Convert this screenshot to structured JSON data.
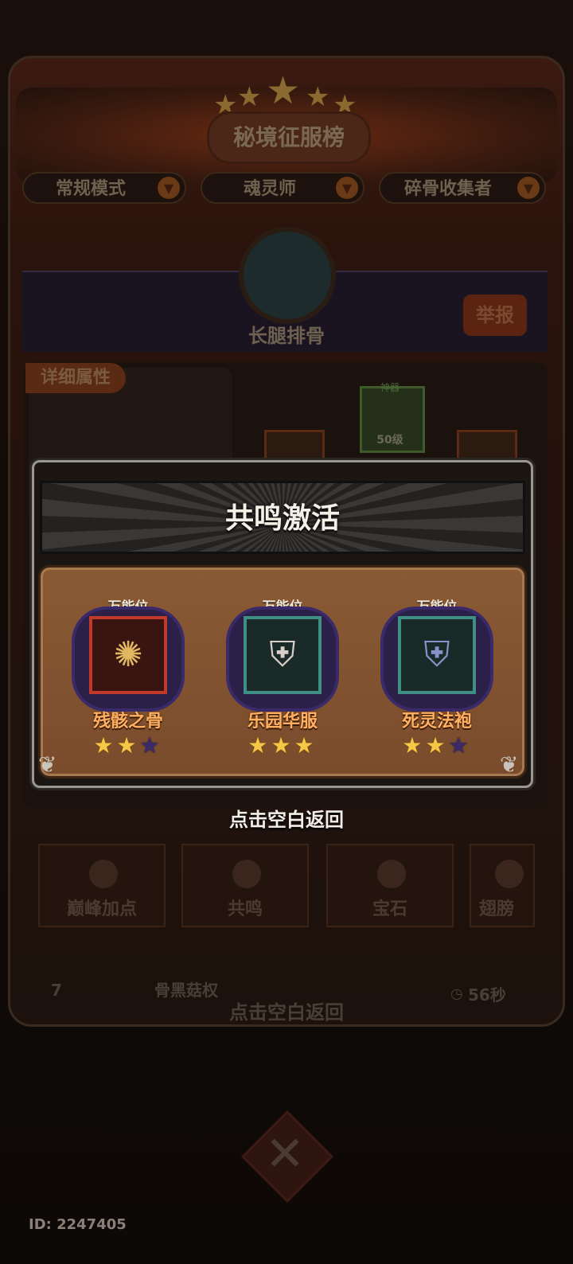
{
  "background": {
    "board_title": "秘境征服榜",
    "filters": [
      {
        "label": "常规模式"
      },
      {
        "label": "魂灵师"
      },
      {
        "label": "碎骨收集者"
      }
    ],
    "player_name": "长腿排骨",
    "report_label": "举报",
    "detail_tab": "详细属性",
    "legend_tag": "神器",
    "legend_level": "50级",
    "tabs": [
      {
        "label": "巅峰加点"
      },
      {
        "label": "共鸣"
      },
      {
        "label": "宝石"
      },
      {
        "label": "翅膀"
      }
    ],
    "row_rank": "7",
    "row_name": "骨黑菇权",
    "row_time": "56秒",
    "bottom_hint": "点击空白返回",
    "player_id": "ID: 2247405"
  },
  "modal": {
    "title": "共鸣激活",
    "slots": [
      {
        "tag": "万能位",
        "name": "残骸之骨",
        "stars": 2,
        "max_stars": 3,
        "border_color": "#c0392b",
        "icon": "bone-scarab-icon"
      },
      {
        "tag": "万能位",
        "name": "乐园华服",
        "stars": 3,
        "max_stars": 3,
        "border_color": "#3f8f86",
        "icon": "armor-icon"
      },
      {
        "tag": "万能位",
        "name": "死灵法袍",
        "stars": 2,
        "max_stars": 3,
        "border_color": "#3f8f86",
        "icon": "robe-icon"
      }
    ],
    "hint": "点击空白返回"
  }
}
